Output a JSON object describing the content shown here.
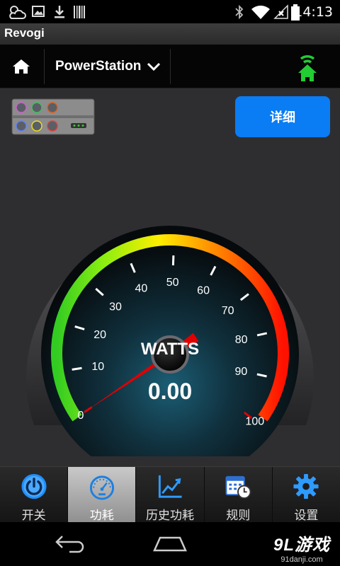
{
  "status_bar": {
    "time": "14:13",
    "icons": [
      "weather-icon",
      "image-icon",
      "download-icon",
      "barcode-icon",
      "bluetooth-icon",
      "wifi-icon",
      "no-sim-icon",
      "battery-icon"
    ]
  },
  "app": {
    "title": "Revogi"
  },
  "nav": {
    "device_name": "PowerStation",
    "connection_color": "#22cc33"
  },
  "main": {
    "detail_button": "详细"
  },
  "gauge": {
    "ticks": [
      "0",
      "10",
      "20",
      "30",
      "40",
      "50",
      "60",
      "70",
      "80",
      "90",
      "100"
    ],
    "unit": "WATTS",
    "value": "0.00",
    "needle_color": "#e00000"
  },
  "tabs": [
    {
      "label": "开关",
      "icon": "power-icon"
    },
    {
      "label": "功耗",
      "icon": "speedometer-icon",
      "active": true
    },
    {
      "label": "历史功耗",
      "icon": "line-chart-icon"
    },
    {
      "label": "规则",
      "icon": "calendar-clock-icon"
    },
    {
      "label": "设置",
      "icon": "gear-icon"
    }
  ],
  "watermark": {
    "main": "9L游戏",
    "sub": "91danji.com"
  }
}
